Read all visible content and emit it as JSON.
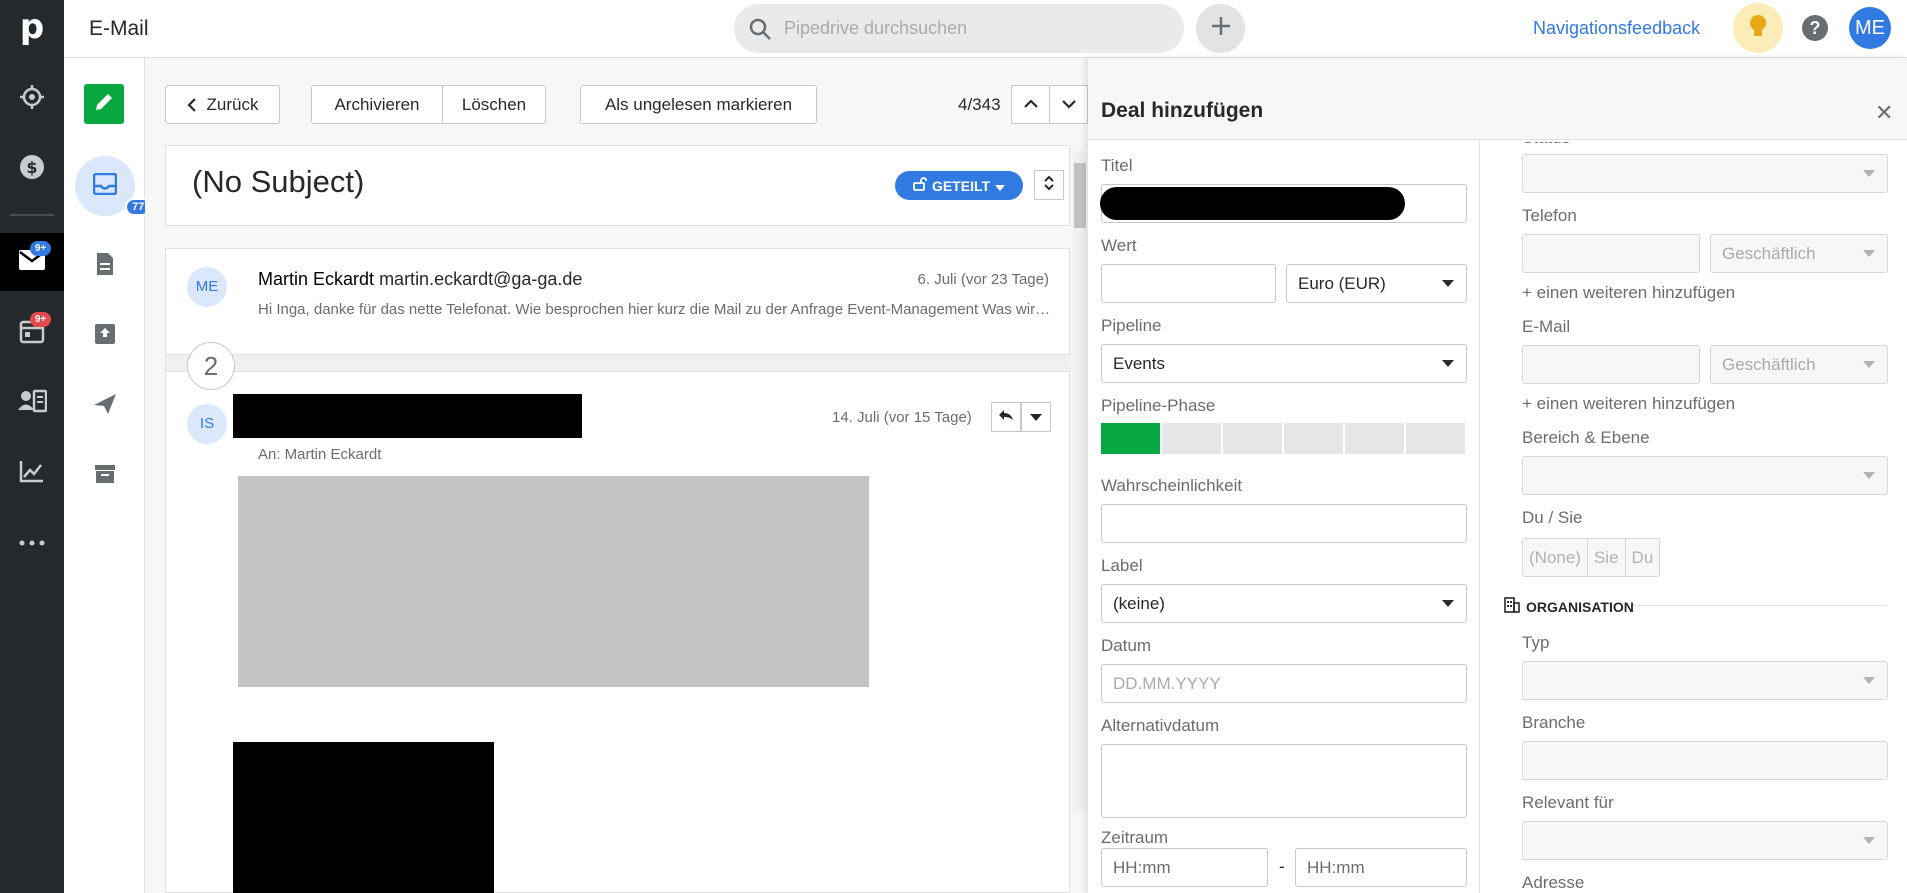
{
  "topbar": {
    "app_title": "E-Mail",
    "search_placeholder": "Pipedrive durchsuchen",
    "nav_feedback": "Navigationsfeedback",
    "help": "?",
    "avatar": "ME"
  },
  "rail": {
    "logo": "p",
    "mail_badge": "9+",
    "calendar_badge": "9+"
  },
  "mailside": {
    "inbox_count": "77"
  },
  "toolbar": {
    "back": "Zurück",
    "archive": "Archivieren",
    "delete": "Löschen",
    "mark_unread": "Als ungelesen markieren",
    "pager": "4/343"
  },
  "thread": {
    "subject": "(No Subject)",
    "shared_label": "GETEILT",
    "collapsed_count": "2",
    "message1": {
      "avatar": "ME",
      "sender_name": "Martin Eckardt",
      "sender_email": "martin.eckardt@ga-ga.de",
      "date": "6. Juli (vor 23 Tage)",
      "preview": "Hi Inga, danke für das nette Telefonat. Wie besprochen hier kurz die Mail zu der Anfrage Event-Management Was wir tran..."
    },
    "message2": {
      "avatar": "IS",
      "date": "14. Juli (vor 15 Tage)",
      "to_line": "An: Martin Eckardt"
    }
  },
  "deal": {
    "title": "Deal hinzufügen",
    "left": {
      "titel_label": "Titel",
      "wert_label": "Wert",
      "currency": "Euro (EUR)",
      "pipeline_label": "Pipeline",
      "pipeline_value": "Events",
      "phase_label": "Pipeline-Phase",
      "phase_count": 6,
      "phase_current": 1,
      "prob_label": "Wahrscheinlichkeit",
      "label_label": "Label",
      "label_value": "(keine)",
      "datum_label": "Datum",
      "datum_placeholder": "DD.MM.YYYY",
      "alt_label": "Alternativdatum",
      "zeitraum_label": "Zeitraum",
      "time_from": "HH:mm",
      "time_sep": "-",
      "time_to": "HH:mm"
    },
    "right": {
      "status_label": "Status",
      "telefon_label": "Telefon",
      "telefon_type": "Geschäftlich",
      "add_phone": "+ einen weiteren hinzufügen",
      "email_label": "E-Mail",
      "email_type": "Geschäftlich",
      "add_email": "+ einen weiteren hinzufügen",
      "bereich_label": "Bereich & Ebene",
      "dusie_label": "Du / Sie",
      "dusie_options": [
        "(None)",
        "Sie",
        "Du"
      ],
      "org_header": "ORGANISATION",
      "typ_label": "Typ",
      "branche_label": "Branche",
      "relevant_label": "Relevant für",
      "adresse_label": "Adresse"
    }
  }
}
